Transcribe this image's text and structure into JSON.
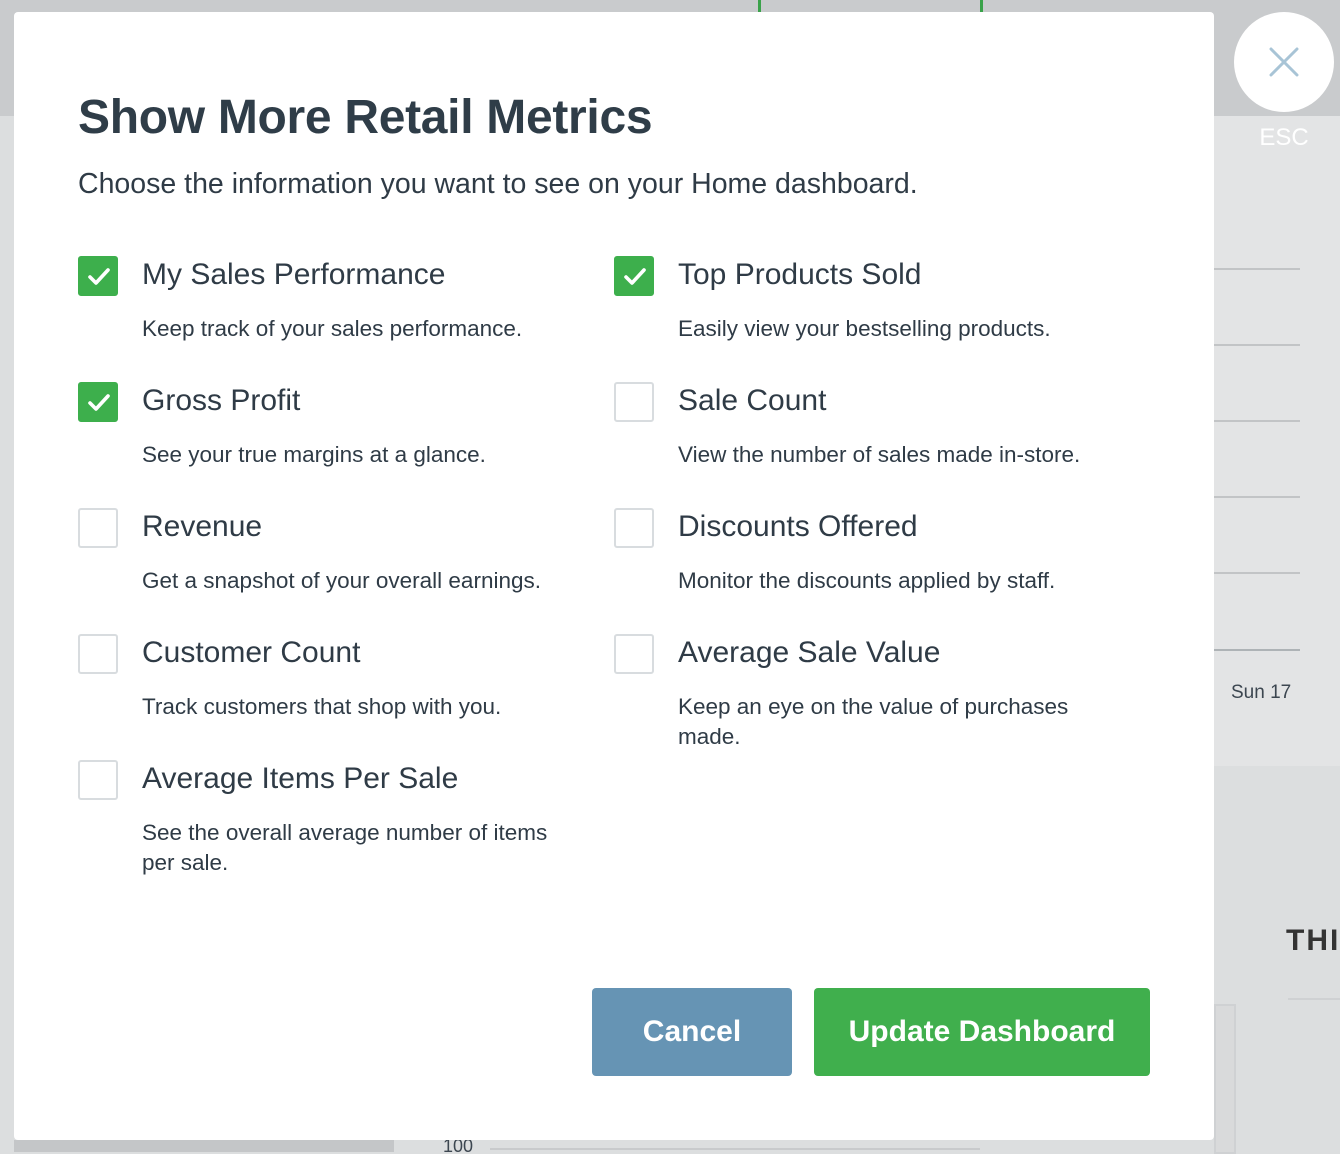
{
  "modal": {
    "title": "Show More Retail Metrics",
    "subtitle": "Choose the information you want to see on your Home dashboard.",
    "metrics": [
      {
        "label": "My Sales Performance",
        "description": "Keep track of your sales performance.",
        "checked": true
      },
      {
        "label": "Top Products Sold",
        "description": "Easily view your bestselling products.",
        "checked": true
      },
      {
        "label": "Gross Profit",
        "description": "See your true margins at a glance.",
        "checked": true
      },
      {
        "label": "Sale Count",
        "description": "View the number of sales made in-store.",
        "checked": false
      },
      {
        "label": "Revenue",
        "description": "Get a snapshot of your overall earnings.",
        "checked": false
      },
      {
        "label": "Discounts Offered",
        "description": "Monitor the discounts applied by staff.",
        "checked": false
      },
      {
        "label": "Customer Count",
        "description": "Track customers that shop with you.",
        "checked": false
      },
      {
        "label": "Average Sale Value",
        "description": "Keep an eye on the value of purchases made.",
        "checked": false
      },
      {
        "label": "Average Items Per Sale",
        "description": "See the overall average number of items per sale.",
        "checked": false
      }
    ],
    "cancel_label": "Cancel",
    "update_label": "Update Dashboard"
  },
  "close": {
    "esc_label": "ESC"
  },
  "background": {
    "chart_date_label": "Sun 17",
    "axis_tick_label": "100",
    "section_fragment": "THI"
  },
  "colors": {
    "checked": "#3daf4c",
    "cancel_button": "#6694b4",
    "update_button": "#40af4d"
  }
}
